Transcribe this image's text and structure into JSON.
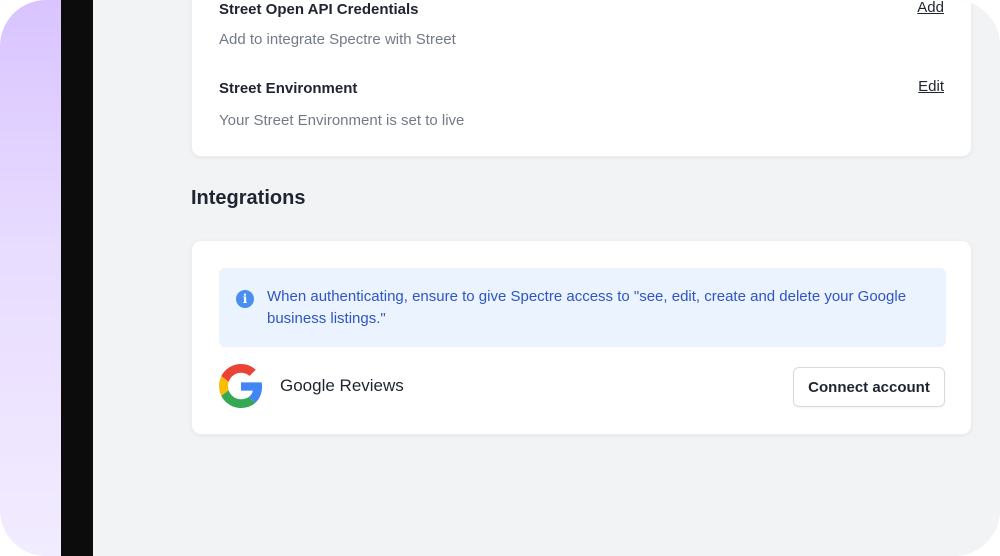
{
  "credentials_card": {
    "rows": [
      {
        "title": "Street Open API Credentials",
        "description": "Add to integrate Spectre with Street",
        "action": "Add"
      },
      {
        "title": "Street Environment",
        "description": "Your Street Environment is set to live",
        "action": "Edit"
      }
    ]
  },
  "integrations": {
    "heading": "Integrations",
    "notice": {
      "icon": "info-icon",
      "icon_glyph": "i",
      "text": "When authenticating, ensure to give Spectre access to \"see, edit, create and delete your Google business listings.\""
    },
    "items": [
      {
        "icon": "google-icon",
        "name": "Google Reviews",
        "button_label": "Connect account"
      }
    ]
  },
  "colors": {
    "info_background": "#ebf3fe",
    "info_text": "#2f55c4",
    "page_background": "#f2f3f5"
  }
}
